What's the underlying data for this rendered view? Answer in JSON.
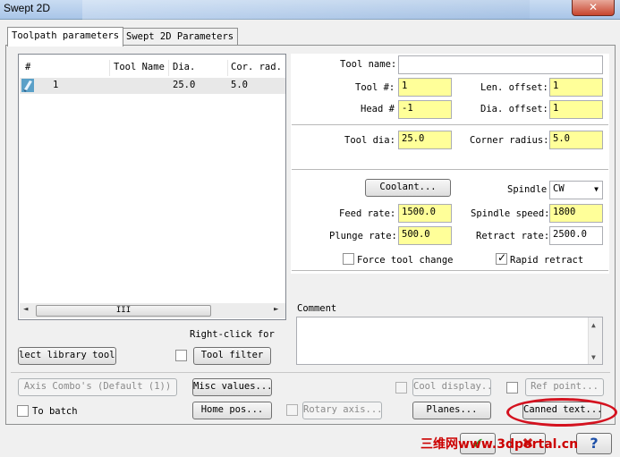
{
  "window": {
    "title": "Swept 2D",
    "close_icon": "close-icon"
  },
  "tabs": [
    {
      "label": "Toolpath parameters",
      "active": true
    },
    {
      "label": "Swept 2D Parameters",
      "active": false
    }
  ],
  "tool_list": {
    "columns": [
      "#",
      "Tool Name",
      "Dia.",
      "Cor. rad."
    ],
    "rows": [
      {
        "icon": "endmill-tool-icon",
        "number": "1",
        "name": "",
        "dia": "25.0",
        "cor_rad": "5.0"
      }
    ],
    "scroll_grip": "III"
  },
  "fields": {
    "tool_name": {
      "label": "Tool name:",
      "value": ""
    },
    "tool_num": {
      "label": "Tool #:",
      "value": "1"
    },
    "len_offset": {
      "label": "Len. offset:",
      "value": "1"
    },
    "head_num": {
      "label": "Head #",
      "value": "-1"
    },
    "dia_offset": {
      "label": "Dia. offset:",
      "value": "1"
    },
    "tool_dia": {
      "label": "Tool dia:",
      "value": "25.0"
    },
    "corner_radius": {
      "label": "Corner radius:",
      "value": "5.0"
    },
    "spindle": {
      "label": "Spindle",
      "value": "CW"
    },
    "feed_rate": {
      "label": "Feed rate:",
      "value": "1500.0"
    },
    "spindle_speed": {
      "label": "Spindle speed:",
      "value": "1800"
    },
    "plunge_rate": {
      "label": "Plunge rate:",
      "value": "500.0"
    },
    "retract_rate": {
      "label": "Retract rate:",
      "value": "2500.0"
    }
  },
  "checkboxes": {
    "force_tool_change": {
      "label": "Force tool change",
      "checked": false
    },
    "rapid_retract": {
      "label": "Rapid retract",
      "checked": true
    },
    "to_batch": {
      "label": "To batch",
      "checked": false
    }
  },
  "buttons": {
    "coolant": "Coolant...",
    "select_library_tool": "lect library tool.",
    "tool_filter": "Tool filter",
    "axis_combo": "Axis Combo's (Default (1))",
    "misc_values": "Misc values...",
    "tool_display": "Cool display...",
    "ref_point": "Ref point...",
    "home_pos": "Home pos...",
    "rotary_axis": "Rotary axis...",
    "planes": "Planes...",
    "canned_text": "Canned text..."
  },
  "labels": {
    "right_click_hint": "Right-click for",
    "comment": "Comment"
  },
  "comment_text": "",
  "watermark": "三维网www.3dportal.cn",
  "bottom_buttons": [
    {
      "name": "ok-check-icon",
      "glyph": "✔"
    },
    {
      "name": "cancel-x-icon",
      "glyph": "✖"
    },
    {
      "name": "help-question-icon",
      "glyph": "?"
    }
  ],
  "colors": {
    "highlight_field": "#ffff99",
    "annotation_red": "#d4121f"
  }
}
